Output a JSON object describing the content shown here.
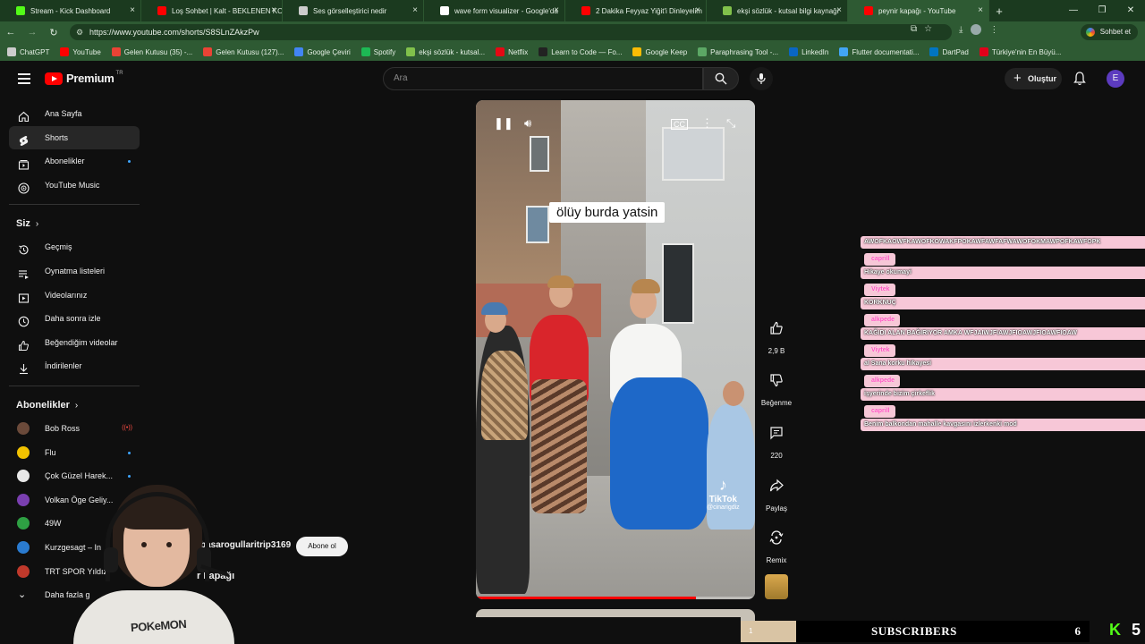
{
  "browser": {
    "tabs": [
      {
        "title": "Stream - Kick Dashboard",
        "color": "#53fc18"
      },
      {
        "title": "Loş Sohbet | Kalt - BEKLENEN KO",
        "color": "#ff0000"
      },
      {
        "title": "Ses görselleştirici nedir",
        "color": "#cccccc"
      },
      {
        "title": "wave form visualizer - Google'da",
        "color": "#ffffff"
      },
      {
        "title": "2 Dakika Feyyaz Yiğit'i Dinleyelim",
        "color": "#ff0000"
      },
      {
        "title": "ekşi sözlük - kutsal bilgi kaynağı",
        "color": "#81c14b"
      },
      {
        "title": "peynir kapağı - YouTube",
        "color": "#ff0000"
      }
    ],
    "url": "https://www.youtube.com/shorts/S8SLnZAkzPw",
    "chat_button": "Sohbet et",
    "bookmarks": [
      {
        "label": "ChatGPT",
        "color": "#cccccc"
      },
      {
        "label": "YouTube",
        "color": "#ff0000"
      },
      {
        "label": "Gelen Kutusu (35) -...",
        "color": "#ea4335"
      },
      {
        "label": "Gelen Kutusu (127)...",
        "color": "#ea4335"
      },
      {
        "label": "Google Çeviri",
        "color": "#4285f4"
      },
      {
        "label": "Spotify",
        "color": "#1db954"
      },
      {
        "label": "ekşi sözlük - kutsal...",
        "color": "#81c14b"
      },
      {
        "label": "Netflix",
        "color": "#e50914"
      },
      {
        "label": "Learn to Code — Fo...",
        "color": "#222222"
      },
      {
        "label": "Google Keep",
        "color": "#fbbc05"
      },
      {
        "label": "Paraphrasing Tool -...",
        "color": "#5ca865"
      },
      {
        "label": "LinkedIn",
        "color": "#0a66c2"
      },
      {
        "label": "Flutter documentati...",
        "color": "#42a5f5"
      },
      {
        "label": "DartPad",
        "color": "#0175c2"
      },
      {
        "label": "Türkiye'nin En Büyü...",
        "color": "#e2001a"
      }
    ]
  },
  "youtube": {
    "logo_text": "Premium",
    "logo_sup": "TR",
    "search_placeholder": "Ara",
    "create_label": "Oluştur",
    "avatar_letter": "E",
    "nav": [
      {
        "label": "Ana Sayfa",
        "icon": "home-icon"
      },
      {
        "label": "Shorts",
        "icon": "shorts-icon"
      },
      {
        "label": "Abonelikler",
        "icon": "subscriptions-icon"
      },
      {
        "label": "YouTube Music",
        "icon": "music-icon"
      }
    ],
    "you_heading": "Siz",
    "you_items": [
      {
        "label": "Geçmiş",
        "icon": "history-icon"
      },
      {
        "label": "Oynatma listeleri",
        "icon": "playlist-icon"
      },
      {
        "label": "Videolarınız",
        "icon": "your-videos-icon"
      },
      {
        "label": "Daha sonra izle",
        "icon": "watch-later-icon"
      },
      {
        "label": "Beğendiğim videolar",
        "icon": "liked-icon"
      },
      {
        "label": "İndirilenler",
        "icon": "downloads-icon"
      }
    ],
    "subs_heading": "Abonelikler",
    "subscriptions": [
      {
        "label": "Bob Ross",
        "color": "#6b4a3a"
      },
      {
        "label": "Flu",
        "color": "#f2c200"
      },
      {
        "label": "Çok Güzel Harek...",
        "color": "#e8e8e8"
      },
      {
        "label": "Volkan Öge Geliy...",
        "color": "#7a3fb0"
      },
      {
        "label": "49W",
        "color": "#2ea043"
      },
      {
        "label": "Kurzgesagt – In",
        "color": "#2a7bd0"
      },
      {
        "label": "TRT SPOR Yıldız",
        "color": "#c0392b"
      }
    ],
    "more_label": "Daha fazla g",
    "short": {
      "caption": "ölüy burda yatsin",
      "tiktok": "TikTok",
      "tiktok_handle": "@cinarigdiz",
      "channel": "basarogullaritrip3169",
      "subscribe": "Abone ol",
      "title": "r kapağı",
      "likes": "2,9 B",
      "dislike": "Beğenme",
      "comments": "220",
      "share": "Paylaş",
      "remix": "Remix",
      "progress": 0.79
    }
  },
  "chat": [
    {
      "user": "",
      "message": "AWOFKAOWFKAWOFKOWAKFPOKAWFAWFAFWAWOFOKMAWPOFKAWFOPK"
    },
    {
      "user": "caprill",
      "message": "Hikaye okumayi"
    },
    {
      "user": "Viytek",
      "message": "KORKNUÇ"
    },
    {
      "user": "alkpede",
      "message": "KAĞIDI ALAN BAĞIRIYOR AMKA WFJAIWJFIAWJFIOAWJFIOAWFIOAW"
    },
    {
      "user": "Viytek",
      "message": "al Sana korku hikayesi"
    },
    {
      "user": "alkpede",
      "message": "işyerinde bizim çirkeflik"
    },
    {
      "user": "caprill",
      "message": "Benim balkondan mahalle kavgasını izlerkenki mod"
    }
  ],
  "overlay": {
    "subscribers_label": "SUBSCRIBERS",
    "subscribers_current": "1",
    "subscribers_goal": "6",
    "subscribers_fraction": 0.16,
    "kick_letter": "K",
    "kick_count": "5"
  },
  "webcam": {
    "shirt_text": "POKeMON"
  }
}
